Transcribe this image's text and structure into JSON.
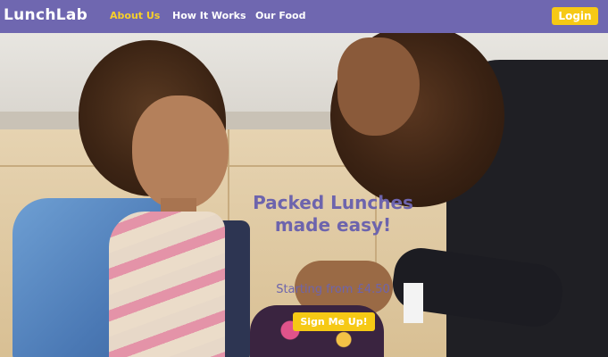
{
  "brand": {
    "logo_text": "LunchLab",
    "primary_color": "#6f67b0",
    "accent_color": "#f6c915"
  },
  "nav": {
    "links": [
      {
        "label": "About Us",
        "active": true
      },
      {
        "label": "How It Works",
        "active": false
      },
      {
        "label": "Our Food",
        "active": false
      }
    ],
    "login_label": "Login"
  },
  "hero": {
    "headline_line1": "Packed Lunches",
    "headline_line2": "made easy!",
    "price_text": "Starting from £4.50",
    "cta_label": "Sign Me Up!"
  }
}
